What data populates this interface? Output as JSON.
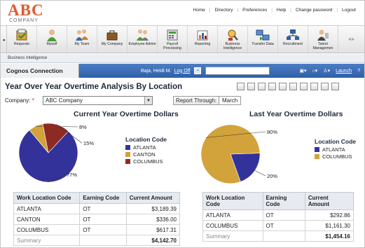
{
  "header": {
    "logo_main": "ABC",
    "logo_sub": "COMPANY",
    "links": [
      "Home",
      "Directory",
      "Preferences",
      "Help",
      "Change password",
      "Logout"
    ]
  },
  "toolbar": {
    "items": [
      {
        "label": "Requests",
        "icon": "requests-icon"
      },
      {
        "label": "Myself",
        "icon": "person-icon"
      },
      {
        "label": "My Team",
        "icon": "team-icon"
      },
      {
        "label": "My Company",
        "icon": "briefcase-icon"
      },
      {
        "label": "Employee Admin",
        "icon": "employee-admin-icon"
      },
      {
        "label": "Payroll Processing",
        "icon": "payroll-icon"
      },
      {
        "label": "Reporting",
        "icon": "bar-chart-icon"
      },
      {
        "label": "Business Intelligence",
        "icon": "magnifier-icon"
      },
      {
        "label": "Transfer Data",
        "icon": "transfer-icon"
      },
      {
        "label": "Recruitment",
        "icon": "network-icon"
      },
      {
        "label": "Talent Managemen",
        "icon": "talent-icon"
      }
    ],
    "left_arrow": "◂",
    "right_arrow": "«»"
  },
  "breadcrumb": "Business Intelligence",
  "cognos": {
    "title": "Cognos Connection",
    "user": "Baja, Heidi M.",
    "logoff": "Log Off",
    "launch": "Launch",
    "help": "?"
  },
  "report": {
    "title": "Year Over Year Overtime Analysis By Location",
    "company_label": "Company:",
    "company_value": "ABC Company",
    "report_through_label": "Report Through:",
    "report_through_value": "March"
  },
  "colors": {
    "atlanta": "#33329b",
    "canton": "#d2a23b",
    "columbus": "#8e2a24"
  },
  "chart_data": [
    {
      "type": "pie",
      "title": "Current Year Overtime Dollars",
      "legend_title": "Location Code",
      "legend": [
        "ATLANTA",
        "CANTON",
        "COLUMBUS"
      ],
      "values": [
        77,
        8,
        15
      ],
      "labels": [
        "77%",
        "8%",
        "15%"
      ]
    },
    {
      "type": "pie",
      "title": "Last Year Overtime Dollars",
      "legend_title": "Location Code",
      "legend": [
        "ATLANTA",
        "COLUMBUS"
      ],
      "values": [
        20,
        80
      ],
      "labels": [
        "20%",
        "80%"
      ]
    }
  ],
  "tables": {
    "headers": [
      "Work Location Code",
      "Earning Code",
      "Current Amount"
    ],
    "current": {
      "rows": [
        [
          "ATLANTA",
          "OT",
          "$3,189.39"
        ],
        [
          "CANTON",
          "OT",
          "$336.00"
        ],
        [
          "COLUMBUS",
          "OT",
          "$617.31"
        ]
      ],
      "summary_label": "Summary",
      "summary_value": "$4,142.70"
    },
    "last": {
      "rows": [
        [
          "ATLANTA",
          "OT",
          "$292.86"
        ],
        [
          "COLUMBUS",
          "OT",
          "$1,161.30"
        ]
      ],
      "summary_label": "Summary",
      "summary_value": "$1,454.16"
    }
  }
}
